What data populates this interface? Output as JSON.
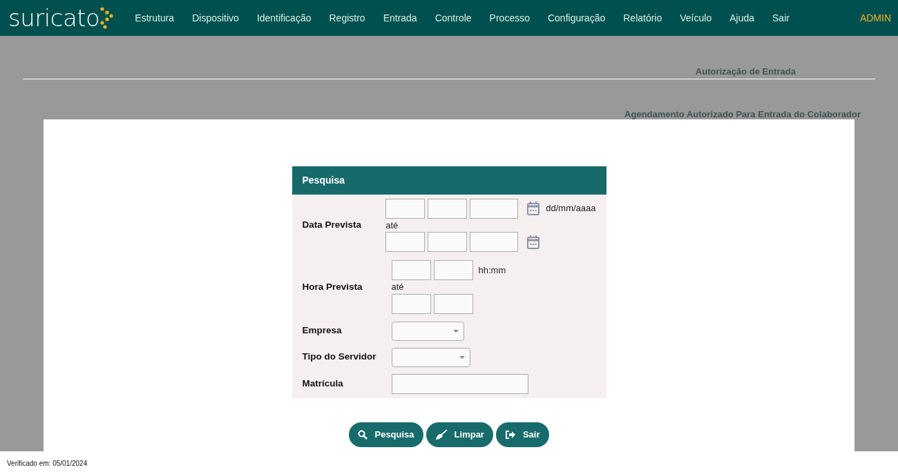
{
  "navbar": {
    "logo": "suricato",
    "items": [
      "Estrutura",
      "Dispositivo",
      "Identificação",
      "Registro",
      "Entrada",
      "Controle",
      "Processo",
      "Configuração",
      "Relatório",
      "Veículo",
      "Ajuda",
      "Sair"
    ],
    "user": "ADMIN"
  },
  "page": {
    "title": "Autorização de Entrada",
    "subtitle": "Agendamento Autorizado Para Entrada do Colaborador"
  },
  "search_panel": {
    "title": "Pesquisa",
    "rows": [
      {
        "kind": "date_range",
        "label": "Data Prevista",
        "format": "dd/mm/aaaa",
        "separator": "até"
      },
      {
        "kind": "time_range",
        "label": "Hora Prevista",
        "format": "hh:mm",
        "separator": "até"
      },
      {
        "kind": "select",
        "label": "Empresa"
      },
      {
        "kind": "select",
        "label": "Tipo do Servidor"
      },
      {
        "kind": "text",
        "label": "Matrícula"
      }
    ]
  },
  "buttons": [
    {
      "kind": "search",
      "label": "Pesquisa"
    },
    {
      "kind": "clear",
      "label": "Limpar"
    },
    {
      "kind": "exit",
      "label": "Sair"
    }
  ],
  "footer": "Verificado em: 05/01/2024"
}
